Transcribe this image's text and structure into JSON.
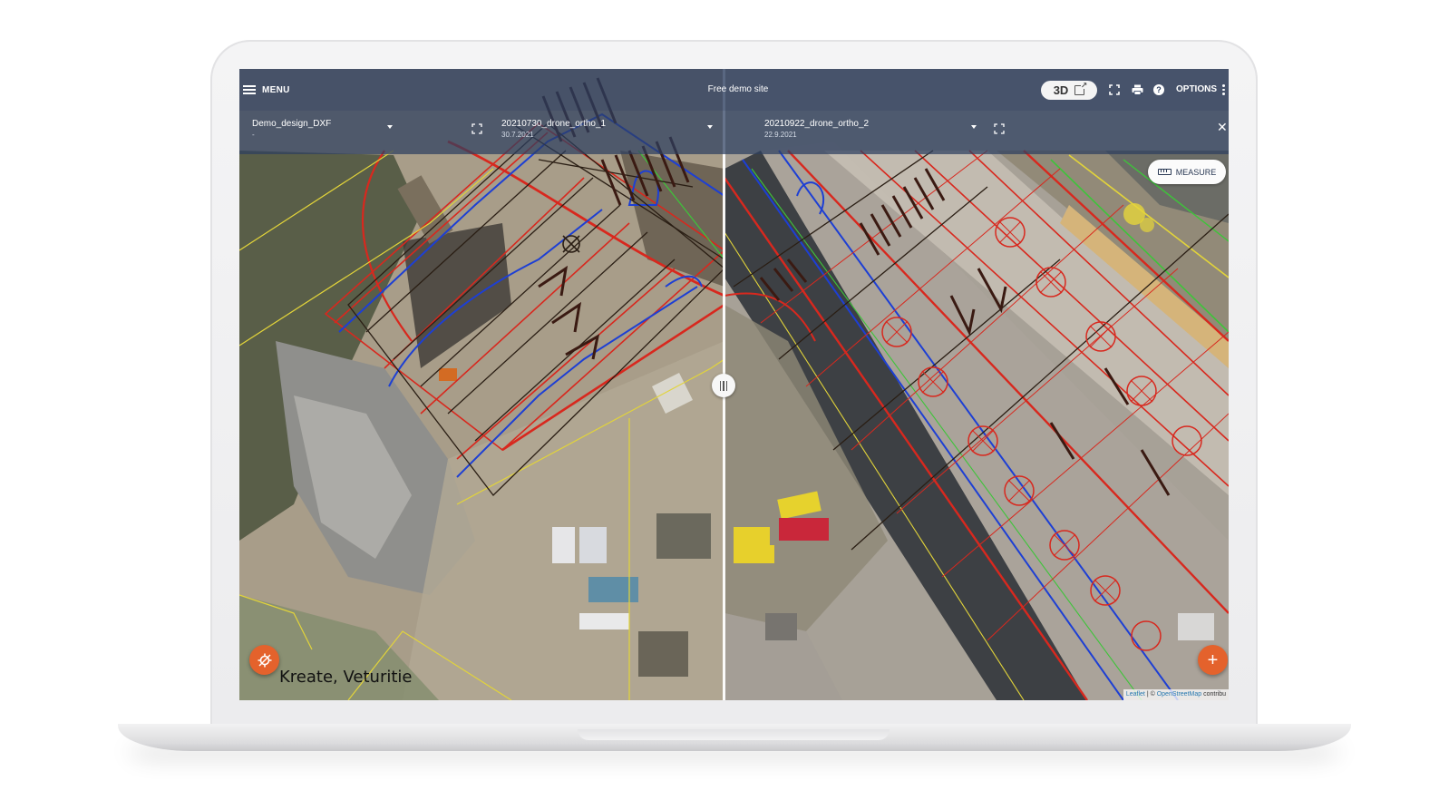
{
  "header": {
    "menu_label": "MENU",
    "site_title": "Free demo site",
    "btn_3d_label": "3D",
    "options_label": "OPTIONS",
    "help_glyph": "?"
  },
  "layers": {
    "design": {
      "name": "Demo_design_DXF",
      "date": "-"
    },
    "left_ortho": {
      "name": "20210730_drone_ortho_1",
      "date": "30.7.2021"
    },
    "right_ortho": {
      "name": "20210922_drone_ortho_2",
      "date": "22.9.2021"
    },
    "close_glyph": "✕"
  },
  "map": {
    "measure_label": "MEASURE",
    "location_label": "Kreate, Veturitie",
    "add_glyph": "+",
    "attribution": {
      "leaflet": "Leaflet",
      "separator": "| ©",
      "osm": "OpenStreetMap",
      "suffix": "contribu"
    }
  },
  "colors": {
    "header_bg": "#2c3e5f",
    "accent_orange": "#e4622c",
    "design_red": "#d8281e",
    "design_blue": "#1d3fd4",
    "design_yellow": "#e2d43a",
    "design_green": "#3ec43a"
  },
  "icons": [
    "hamburger-icon",
    "external-link-icon",
    "fullscreen-icon",
    "print-icon",
    "help-icon",
    "kebab-icon",
    "dropdown-caret-icon",
    "expand-icon",
    "close-icon",
    "ruler-icon",
    "geolocate-icon",
    "plus-icon"
  ]
}
